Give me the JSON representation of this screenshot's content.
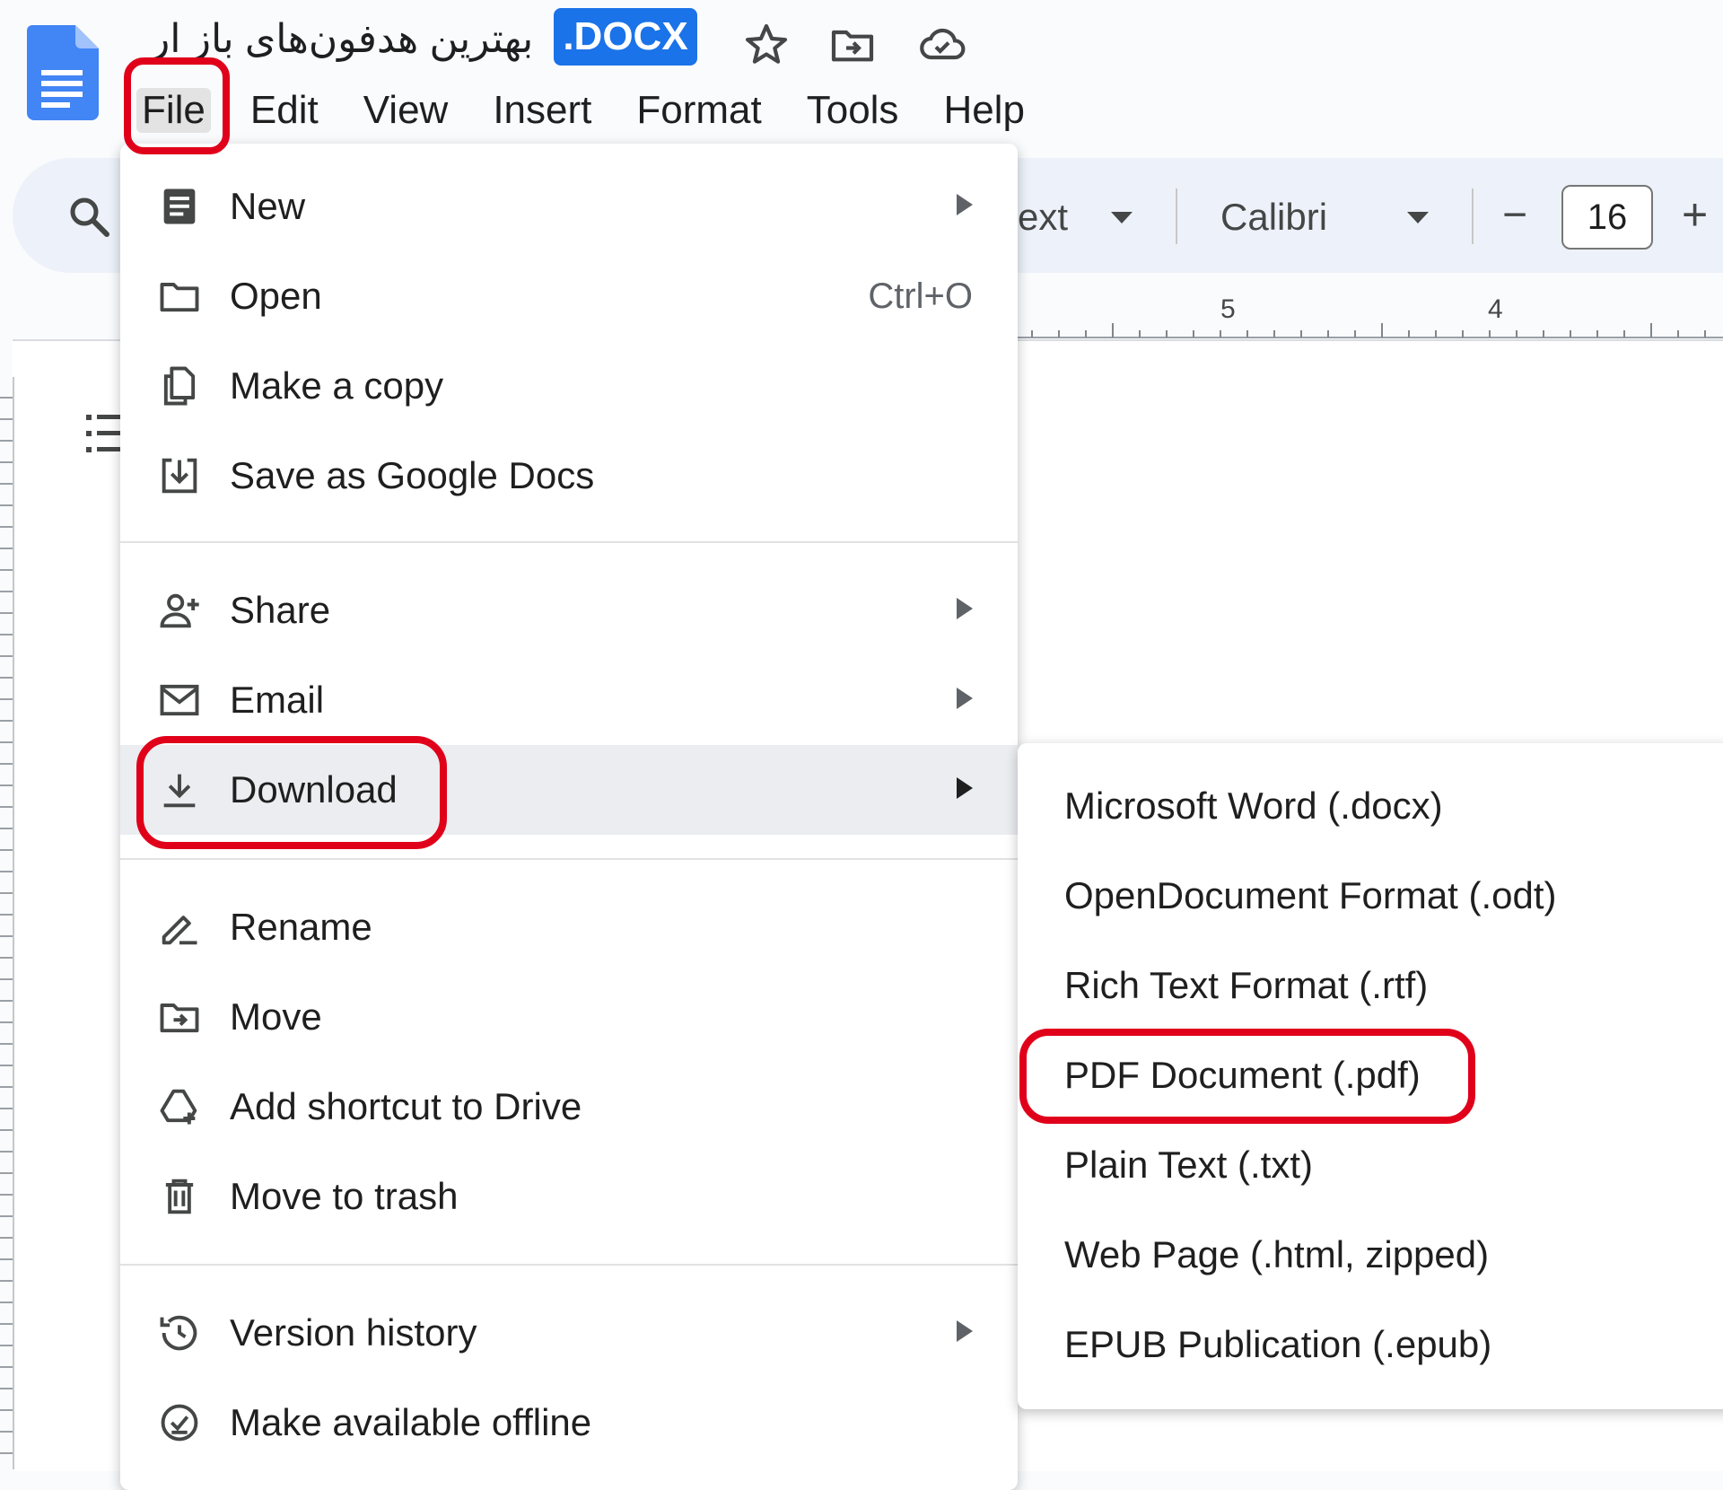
{
  "header": {
    "doc_title": "بهترین هدفون‌های باز ار",
    "file_extension_badge": ".DOCX",
    "icons": [
      "star-icon",
      "move-to-folder-icon",
      "cloud-saved-icon"
    ]
  },
  "menubar": {
    "items": [
      {
        "label": "File"
      },
      {
        "label": "Edit"
      },
      {
        "label": "View"
      },
      {
        "label": "Insert"
      },
      {
        "label": "Format"
      },
      {
        "label": "Tools"
      },
      {
        "label": "Help"
      }
    ]
  },
  "toolbar": {
    "style_partial": "ext",
    "font_name": "Calibri",
    "font_size": "16",
    "minus": "−",
    "plus": "+"
  },
  "ruler": {
    "marks": [
      "5",
      "4"
    ]
  },
  "file_menu": {
    "items": [
      {
        "label": "New",
        "icon": "new-document-icon",
        "submenu": true
      },
      {
        "label": "Open",
        "icon": "open-folder-icon",
        "shortcut": "Ctrl+O"
      },
      {
        "label": "Make a copy",
        "icon": "copy-icon"
      },
      {
        "label": "Save as Google Docs",
        "icon": "save-as-icon"
      },
      {
        "label": "Share",
        "icon": "share-person-icon",
        "submenu": true
      },
      {
        "label": "Email",
        "icon": "email-icon",
        "submenu": true
      },
      {
        "label": "Download",
        "icon": "download-icon",
        "submenu": true,
        "highlighted": true
      },
      {
        "label": "Rename",
        "icon": "rename-icon"
      },
      {
        "label": "Move",
        "icon": "move-folder-icon"
      },
      {
        "label": "Add shortcut to Drive",
        "icon": "drive-shortcut-icon"
      },
      {
        "label": "Move to trash",
        "icon": "trash-icon"
      },
      {
        "label": "Version history",
        "icon": "history-icon",
        "submenu": true
      },
      {
        "label": "Make available offline",
        "icon": "offline-icon"
      }
    ]
  },
  "download_submenu": {
    "items": [
      {
        "label": "Microsoft Word (.docx)"
      },
      {
        "label": "OpenDocument Format (.odt)"
      },
      {
        "label": "Rich Text Format (.rtf)"
      },
      {
        "label": "PDF Document (.pdf)"
      },
      {
        "label": "Plain Text (.txt)"
      },
      {
        "label": "Web Page (.html, zipped)"
      },
      {
        "label": "EPUB Publication (.epub)"
      }
    ]
  },
  "colors": {
    "accent": "#1a73e8",
    "annotation": "#e0001a",
    "hover": "#ebedf0"
  }
}
